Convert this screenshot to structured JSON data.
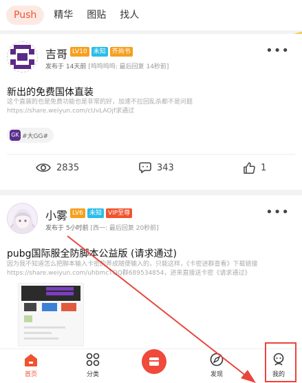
{
  "tabs": [
    {
      "label": "Push",
      "active": true
    },
    {
      "label": "精华",
      "active": false
    },
    {
      "label": "图贴",
      "active": false
    },
    {
      "label": "找人",
      "active": false
    }
  ],
  "posts": [
    {
      "username": "吉哥",
      "badges": [
        {
          "text": "LV10",
          "color": "#f5a020"
        },
        {
          "text": "未知",
          "color": "#2bbde8"
        },
        {
          "text": "齐尚书",
          "color": "#f5a020"
        }
      ],
      "published": "发布于 14天前",
      "meta_extra": "[呜呜呜呜: 最后回复 14秒前]",
      "title": "新出的免费国体直装",
      "desc_lines": [
        "这个直装的也是免费功能也是非常的好，加速不拉回乱杀都不是问题",
        "https://share.weiyun.com/cUvLAOjf求通过"
      ],
      "tag": {
        "logo": "GK",
        "text": "#大GG#"
      },
      "views": "2835",
      "comments": "343",
      "likes": "1"
    },
    {
      "username": "小雾",
      "badges": [
        {
          "text": "LV6",
          "color": "#f5a020"
        },
        {
          "text": "未知",
          "color": "#2bbde8"
        },
        {
          "text": "VIP至尊",
          "color": "#f0532f"
        }
      ],
      "published": "发布于 5小时前",
      "meta_extra": "[西一: 最后回复 20秒前]",
      "title": "pubg国际服全防脚本公益版 (请求通过)",
      "desc_lines": [
        "因为我不知道怎么把脚本输入卡密的弄成随便输入的，只能这样，《卡密进群查看》下载链接",
        "https://share.weiyun.com/uhbmcTQQ群689534854，进来直接送卡密《请求通过》"
      ]
    }
  ],
  "bottom_nav": [
    {
      "label": "首页",
      "icon": "home-icon",
      "active": true
    },
    {
      "label": "分类",
      "icon": "grid-icon",
      "active": false
    },
    {
      "label": "",
      "icon": "publish-icon",
      "active": false
    },
    {
      "label": "发现",
      "icon": "discover-icon",
      "active": false
    },
    {
      "label": "我的",
      "icon": "profile-icon",
      "active": false
    }
  ],
  "colors": {
    "accent": "#f0532f",
    "annotation": "#e8453c"
  }
}
